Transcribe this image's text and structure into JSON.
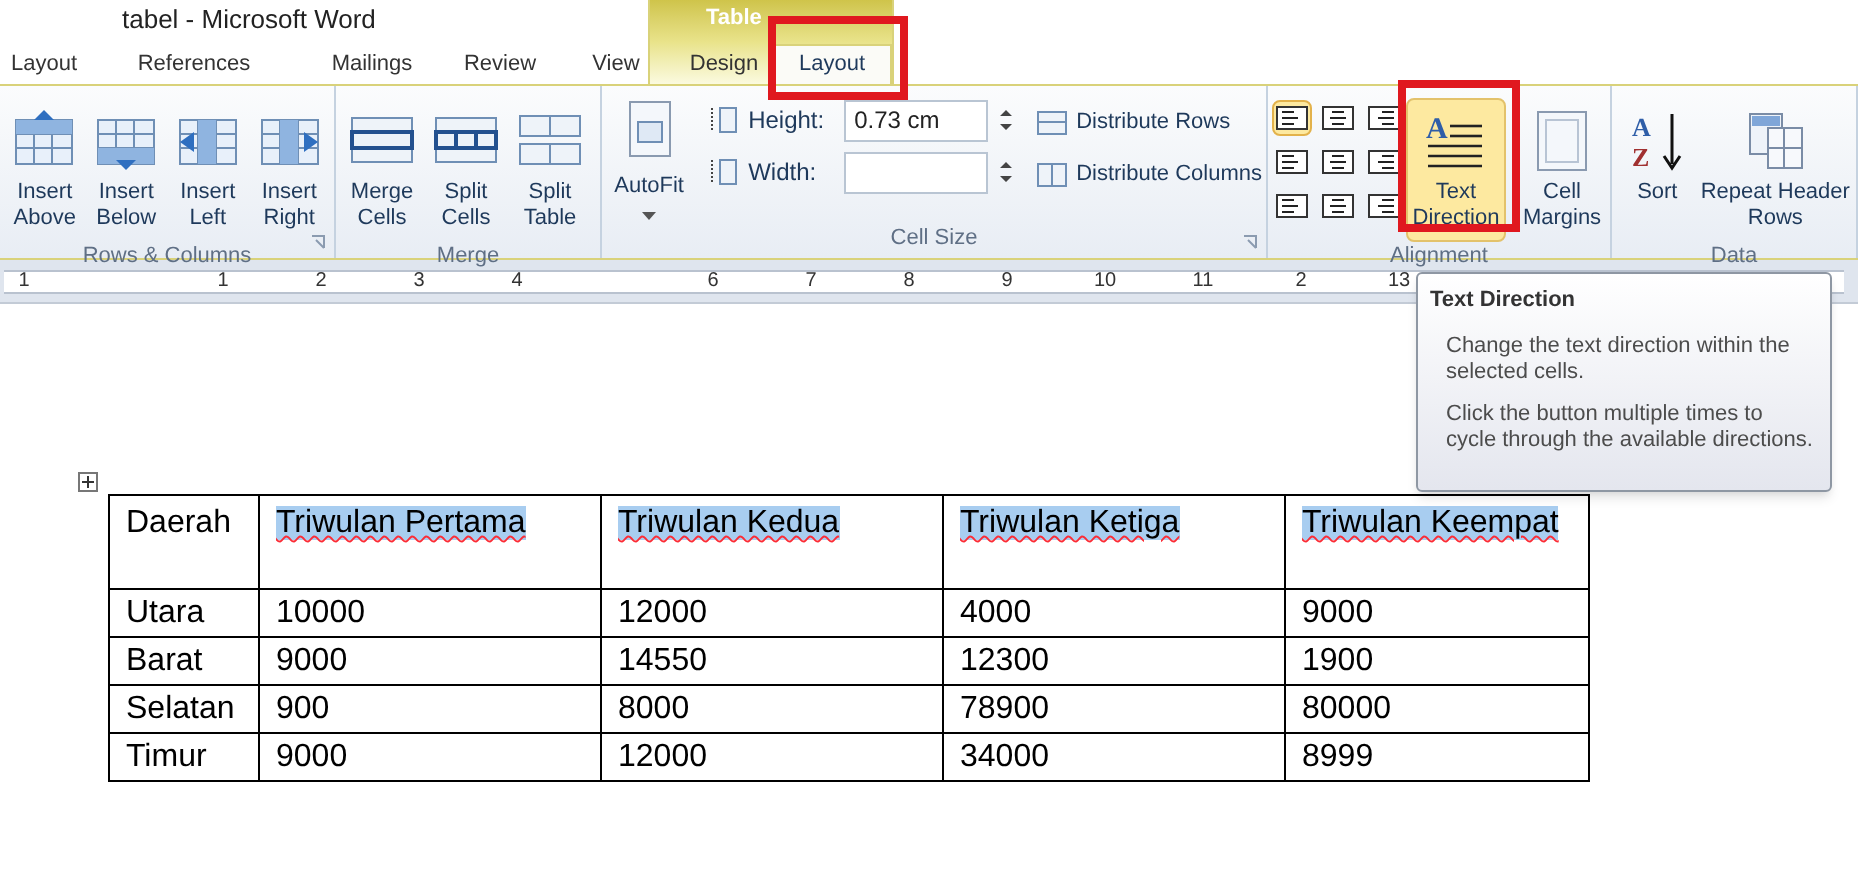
{
  "window": {
    "title": "tabel  -  Microsoft Word",
    "context_tab": "Table"
  },
  "tabs": [
    {
      "label": "Layout",
      "selected": false
    },
    {
      "label": "References",
      "selected": false
    },
    {
      "label": "Mailings",
      "selected": false
    },
    {
      "label": "Review",
      "selected": false
    },
    {
      "label": "View",
      "selected": false
    },
    {
      "label": "Design",
      "selected": false
    },
    {
      "label": "Layout",
      "selected": true
    }
  ],
  "ribbon": {
    "groups": [
      {
        "label": "Rows & Columns",
        "launcher": true,
        "buttons": [
          {
            "label": "Insert Above",
            "kind": "insert-above"
          },
          {
            "label": "Insert Below",
            "kind": "insert-below"
          },
          {
            "label": "Insert Left",
            "kind": "insert-left"
          },
          {
            "label": "Insert Right",
            "kind": "insert-right"
          }
        ]
      },
      {
        "label": "Merge",
        "launcher": false,
        "buttons": [
          {
            "label": "Merge Cells",
            "kind": "merge"
          },
          {
            "label": "Split Cells",
            "kind": "split-cells"
          },
          {
            "label": "Split Table",
            "kind": "split-table"
          }
        ]
      },
      {
        "label": "Cell Size",
        "launcher": true,
        "autofit": "AutoFit",
        "height_label": "Height:",
        "height_value": "0.73 cm",
        "width_label": "Width:",
        "distribute": [
          "Distribute Rows",
          "Distribute Columns"
        ]
      },
      {
        "label": "Alignment",
        "launcher": false,
        "align": [
          {
            "selected": true
          },
          {
            "selected": false
          },
          {
            "selected": false
          },
          {
            "selected": false
          },
          {
            "selected": false
          },
          {
            "selected": false
          },
          {
            "selected": false
          },
          {
            "selected": false
          },
          {
            "selected": false
          }
        ],
        "buttons": [
          {
            "label": "Text Direction",
            "kind": "text-direction",
            "selected": true,
            "icon_letters": [
              "A"
            ]
          },
          {
            "label": "Cell Margins",
            "kind": "margins",
            "selected": false
          }
        ]
      },
      {
        "label": "Data",
        "launcher": false,
        "buttons": [
          {
            "label": "Sort",
            "kind": "sort",
            "icon_letters": [
              "A",
              "Z"
            ]
          },
          {
            "label": "Repeat Header Rows",
            "kind": "repeat"
          }
        ]
      }
    ]
  },
  "ruler": {
    "numbers": [
      "1",
      "1",
      "2",
      "3",
      "4",
      "6",
      "7",
      "8",
      "9",
      "10",
      "11",
      "2",
      "13"
    ]
  },
  "tooltip": {
    "title": "Text Direction",
    "lines": [
      "Change the text direction within the selected cells.",
      "Click the button multiple times to cycle through the available directions."
    ]
  },
  "table": {
    "columns": [
      "Daerah",
      "Triwulan Pertama",
      "Triwulan Kedua",
      "Triwulan Ketiga",
      "Triwulan Keempat"
    ],
    "rows": [
      [
        "Utara",
        "10000",
        "12000",
        "4000",
        "9000"
      ],
      [
        "Barat",
        "9000",
        "14550",
        "12300",
        "1900"
      ],
      [
        "Selatan",
        "900",
        "8000",
        "78900",
        "80000"
      ],
      [
        "Timur",
        "9000",
        "12000",
        "34000",
        "8999"
      ]
    ]
  }
}
